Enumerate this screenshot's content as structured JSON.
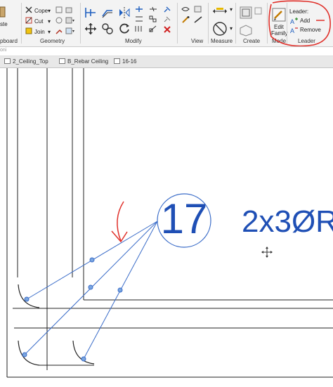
{
  "ribbon": {
    "clipboard_partial": "ste",
    "clipboard_label": "pboard",
    "cope_label": "Cope",
    "cut_label": "Cut",
    "join_label": "Join",
    "geometry_label": "Geometry",
    "modify_label": "Modify",
    "view_label": "View",
    "measure_label": "Measure",
    "create_label": "Create",
    "edit_family_line1": "Edit",
    "edit_family_line2": "Family",
    "mode_label": "Mode",
    "leader_header": "Leader:",
    "leader_add": "Add",
    "leader_remove": "Remove",
    "leader_group_label": "Leader",
    "highlight_color": "#e0302a"
  },
  "subbar": {
    "partial_text": "oni"
  },
  "tabs": [
    {
      "label": "2_Ceiling_Top"
    },
    {
      "label": "B_Rebar Ceiling"
    },
    {
      "label": "16-16"
    }
  ],
  "canvas": {
    "tag_number": "17",
    "rebar_text": "2x3ØR",
    "tag_color": "#1f4fb5",
    "annotation_color": "#e0302a"
  }
}
